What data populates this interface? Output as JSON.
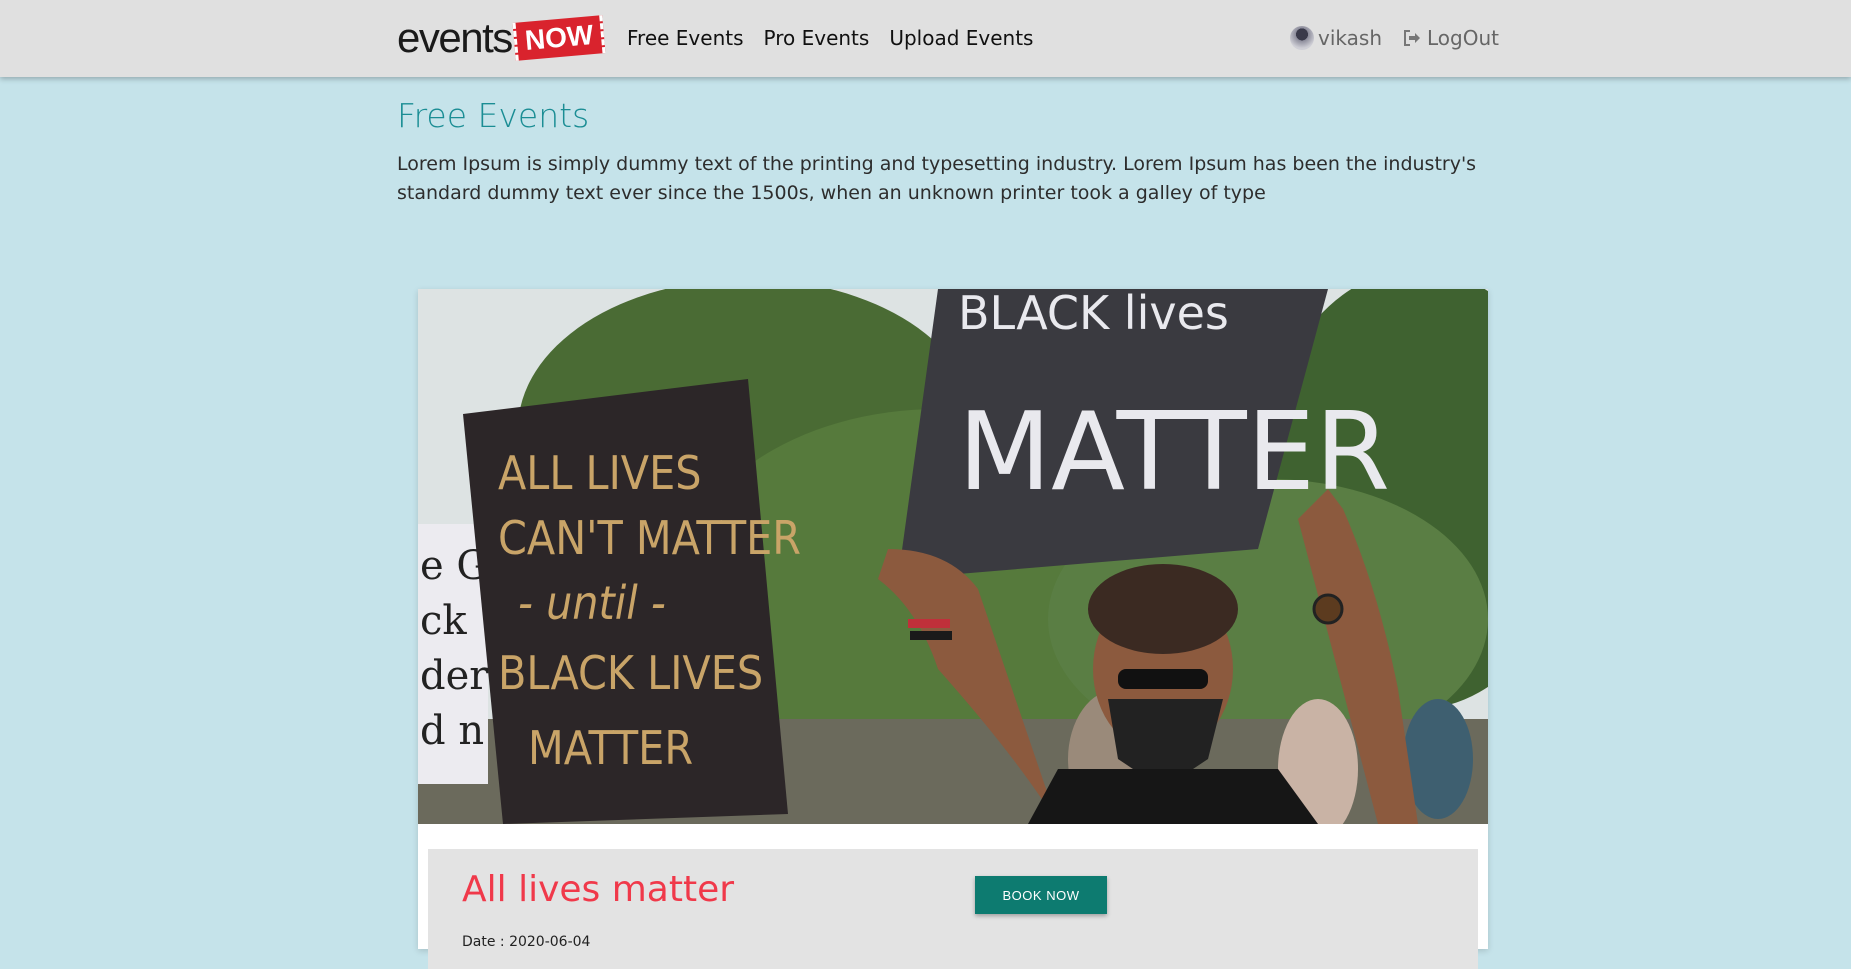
{
  "brand": {
    "logo_text_a": "events",
    "logo_text_b": "NOW",
    "accent_color": "#d9232d"
  },
  "nav": {
    "items": [
      {
        "label": "Free Events"
      },
      {
        "label": "Pro Events"
      },
      {
        "label": "Upload Events"
      }
    ],
    "user_name": "vikash",
    "logout_label": "LogOut"
  },
  "page": {
    "title": "Free Events",
    "description": "Lorem Ipsum is simply dummy text of the printing and typesetting industry. Lorem Ipsum has been the industry's standard dummy text ever since the 1500s, when an unknown printer took a galley of type"
  },
  "event": {
    "title": "All lives matter",
    "book_label": "BOOK NOW",
    "date_text": "Date : 2020-06-04",
    "image": {
      "sign_left": [
        "ALL LIVES",
        "CAN'T MATTER",
        "- until -",
        "BLACK LIVES",
        "MATTER"
      ],
      "sign_right": [
        "BLACK lives",
        "MATTER"
      ]
    }
  },
  "colors": {
    "background": "#c5e3ea",
    "navbar": "#e0e0e0",
    "title": "#1a8d94",
    "event_title": "#f0394a",
    "button": "#0d7b70"
  }
}
